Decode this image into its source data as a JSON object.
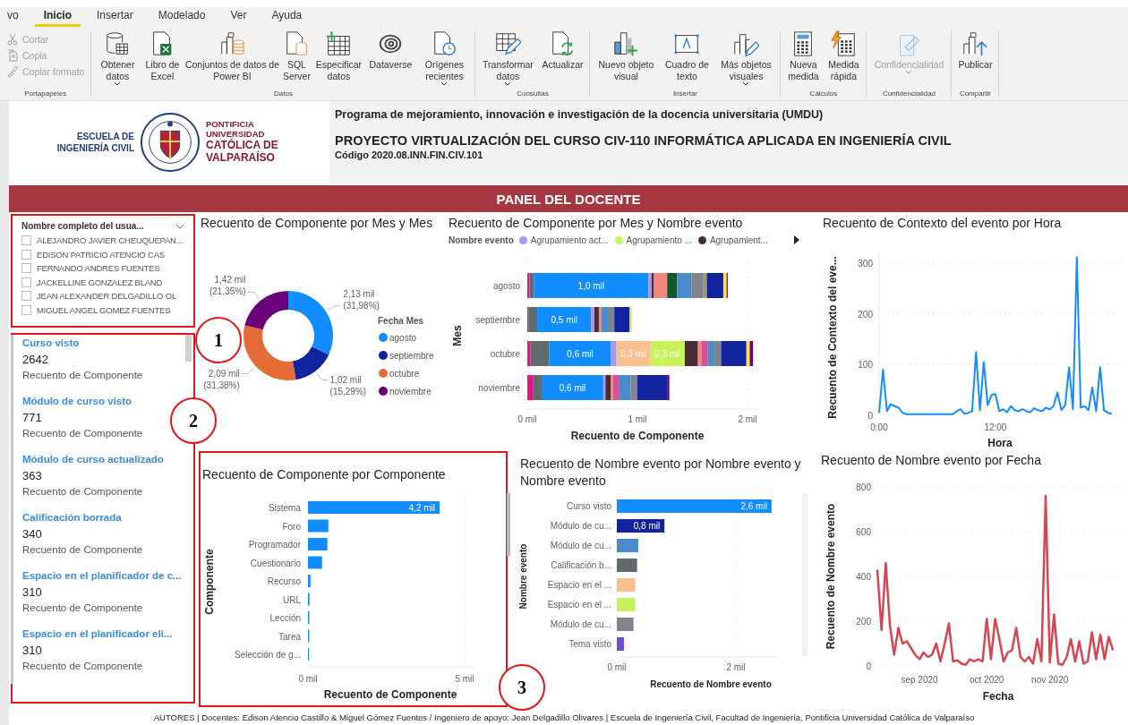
{
  "ribbon": {
    "tabs": [
      {
        "label": "vo",
        "selected": false
      },
      {
        "label": "Inicio",
        "selected": true
      },
      {
        "label": "Insertar",
        "selected": false
      },
      {
        "label": "Modelado",
        "selected": false
      },
      {
        "label": "Ver",
        "selected": false
      },
      {
        "label": "Ayuda",
        "selected": false
      }
    ],
    "groups": [
      {
        "label": "Portapapeles",
        "buttons": [
          {
            "label": "Cortar",
            "kind": "small",
            "disabled": true,
            "menu": false
          },
          {
            "label": "Copia",
            "kind": "small",
            "disabled": true,
            "menu": false
          },
          {
            "label": "Copiar formato",
            "kind": "small",
            "disabled": true,
            "menu": false
          }
        ]
      },
      {
        "label": "Datos",
        "buttons": [
          {
            "label": "Obtener datos",
            "kind": "large",
            "disabled": false,
            "menu": true
          },
          {
            "label": "Libro de Excel",
            "kind": "large",
            "disabled": false,
            "menu": false
          },
          {
            "label": "Conjuntos de datos de Power BI",
            "kind": "large",
            "disabled": false,
            "menu": false
          },
          {
            "label": "SQL Server",
            "kind": "large",
            "disabled": false,
            "menu": false
          },
          {
            "label": "Especificar datos",
            "kind": "large",
            "disabled": false,
            "menu": false
          },
          {
            "label": "Dataverse",
            "kind": "large",
            "disabled": false,
            "menu": false
          },
          {
            "label": "Orígenes recientes",
            "kind": "large",
            "disabled": false,
            "menu": true
          }
        ]
      },
      {
        "label": "Consultas",
        "buttons": [
          {
            "label": "Transformar datos",
            "kind": "large",
            "disabled": false,
            "menu": true
          },
          {
            "label": "Actualizar",
            "kind": "large",
            "disabled": false,
            "menu": false
          }
        ]
      },
      {
        "label": "Insertar",
        "buttons": [
          {
            "label": "Nuevo objeto visual",
            "kind": "large",
            "disabled": false,
            "menu": false
          },
          {
            "label": "Cuadro de texto",
            "kind": "large",
            "disabled": false,
            "menu": false
          },
          {
            "label": "Más objetos visuales",
            "kind": "large",
            "disabled": false,
            "menu": true
          }
        ]
      },
      {
        "label": "Cálculos",
        "buttons": [
          {
            "label": "Nueva medida",
            "kind": "large",
            "disabled": false,
            "menu": false
          },
          {
            "label": "Medida rápida",
            "kind": "large",
            "disabled": false,
            "menu": false
          }
        ]
      },
      {
        "label": "Confidencialidad",
        "buttons": [
          {
            "label": "Confidencialidad",
            "kind": "large",
            "disabled": true,
            "menu": true
          }
        ]
      },
      {
        "label": "Compartir",
        "buttons": [
          {
            "label": "Publicar",
            "kind": "large",
            "disabled": false,
            "menu": false
          }
        ]
      }
    ]
  },
  "header": {
    "logo": {
      "school": "ESCUELA DE INGENIERÍA CIVIL",
      "university_top": "PONTIFICIA UNIVERSIDAD",
      "university_bottom": "CATÓLICA DE VALPARAÍSO"
    },
    "program": "Programa de mejoramiento, innovación e investigación de la docencia universitaria (UMDU)",
    "project": "PROYECTO VIRTUALIZACIÓN DEL CURSO CIV-110 INFORMÁTICA APLICADA EN INGENIERÍA CIVIL",
    "code": "Código 2020.08.INN.FIN.CIV.101"
  },
  "banner": "PANEL DEL DOCENTE",
  "slicer": {
    "annotation": "1",
    "title": "Nombre completo del usua...",
    "items": [
      {
        "label": "ALEJANDRO JAVIER CHEUQUEPAN...",
        "checked": false
      },
      {
        "label": "EDISON PATRICIO ATENCIO CAS",
        "checked": false
      },
      {
        "label": "FERNANDO ANDRES FUENTES",
        "checked": false
      },
      {
        "label": "JACKELLINE GONZALEZ BLAND",
        "checked": false
      },
      {
        "label": "JEAN ALEXANDER DELGADILLO OL",
        "checked": false
      },
      {
        "label": "MIGUEL ANGEL GOMEZ FUENTES",
        "checked": false
      }
    ]
  },
  "cards": {
    "annotation": "2",
    "items": [
      {
        "title": "Curso visto",
        "value": "2642",
        "label": "Recuento de Componente"
      },
      {
        "title": "Módulo de curso visto",
        "value": "771",
        "label": "Recuento de Componente"
      },
      {
        "title": "Módulo de curso actualizado",
        "value": "363",
        "label": "Recuento de Componente"
      },
      {
        "title": "Calificación borrada",
        "value": "340",
        "label": "Recuento de Componente"
      },
      {
        "title": "Espacio en el planificador de c...",
        "value": "310",
        "label": "Recuento de Componente"
      },
      {
        "title": "Espacio en el planificador eli...",
        "value": "310",
        "label": "Recuento de Componente"
      }
    ]
  },
  "donut_chart": {
    "chart_data": {
      "type": "donut",
      "title": "Recuento de Componente por Mes y Mes",
      "legend": {
        "title": "Fecha Mes"
      },
      "categories": [
        "agosto",
        "septiembre",
        "octubre",
        "noviembre"
      ],
      "values": [
        2.13,
        1.02,
        2.09,
        1.42
      ],
      "colors": [
        "#118dff",
        "#12239e",
        "#e66c37",
        "#6b007b"
      ],
      "value_labels": [
        "2,13 mil (31,98%)",
        "1,02 mil (15,29%)",
        "2,09 mil (31,38%)",
        "1,42 mil (21,35%)"
      ]
    }
  },
  "stacked_chart": {
    "chart_data": {
      "type": "bar",
      "orientation": "horizontal",
      "stacked": true,
      "grid": true,
      "title": "Recuento de Componente por Mes y Nombre evento",
      "legend": {
        "title": "Nombre evento"
      },
      "xlabel": "Recuento de Componente",
      "ylabel": "Mes",
      "categories": [
        "agosto",
        "septiembre",
        "octubre",
        "noviembre"
      ],
      "xlim": [
        0,
        2.1
      ],
      "xticks": [
        {
          "value": 0,
          "label": "0 mil"
        },
        {
          "value": 1,
          "label": "1 mil"
        },
        {
          "value": 2,
          "label": "2 mil"
        }
      ],
      "series": [
        {
          "color": "#e6148b",
          "values": [
            0.02,
            0.01,
            0.03,
            0.05
          ]
        },
        {
          "color": "#5f6b6d",
          "values": [
            0.04,
            0.08,
            0.17,
            0.08
          ]
        },
        {
          "color": "#118dff",
          "values": [
            1.04,
            0.49,
            0.56,
            0.56
          ],
          "value_labels": [
            "1,0 mil",
            "0,5 mil",
            "0,6 mil",
            "0,6 mil"
          ]
        },
        {
          "name": "Agrupamiento act...",
          "color": "#a597f3",
          "values": [
            0.03,
            0.03,
            0.05,
            0.02
          ]
        },
        {
          "color": "#f9bf8f",
          "values": [
            0,
            0,
            0.31,
            0
          ],
          "value_labels": [
            null,
            null,
            "0,3 mil",
            null
          ]
        },
        {
          "name": "Agrupamiento ...",
          "color": "#c6f35a",
          "values": [
            0,
            0,
            0.31,
            0
          ],
          "value_labels": [
            null,
            null,
            "0,3 mil",
            null
          ]
        },
        {
          "name": "Agrupamient...",
          "color": "#4a2c36",
          "values": [
            0.02,
            0.04,
            0.12,
            0.05
          ]
        },
        {
          "color": "#f5877f",
          "values": [
            0.12,
            0.02,
            0.03,
            0.02
          ]
        },
        {
          "color": "#d64f9a",
          "values": [
            0,
            0,
            0.06,
            0.05
          ]
        },
        {
          "color": "#0f5a2a",
          "values": [
            0.09,
            0,
            0,
            0
          ]
        },
        {
          "color": "#4a8ccb",
          "values": [
            0.13,
            0.07,
            0.06,
            0.11
          ]
        },
        {
          "color": "#7f858c",
          "values": [
            0.11,
            0.05,
            0.06,
            0.06
          ]
        },
        {
          "color": "#a49488",
          "values": [
            0.03,
            0,
            0,
            0
          ]
        },
        {
          "color": "#12239e",
          "values": [
            0.15,
            0.14,
            0.23,
            0.27
          ]
        },
        {
          "color": "#f2e35a",
          "values": [
            0.03,
            0.02,
            0.03,
            0
          ]
        },
        {
          "color": "#6b007b",
          "values": [
            0.01,
            0,
            0.03,
            0.02
          ]
        }
      ]
    }
  },
  "hour_chart": {
    "chart_data": {
      "type": "line",
      "grid": true,
      "title": "Recuento de Contexto del evento por Hora",
      "xlabel": "Hora",
      "ylabel": "Recuento de Contexto del eve...",
      "categories": [
        "0:00",
        null,
        null,
        null,
        null,
        null,
        null,
        null,
        null,
        null,
        null,
        null,
        null,
        null,
        null,
        null,
        null,
        null,
        null,
        null,
        null,
        null,
        null,
        null,
        null,
        null,
        null,
        null,
        null,
        null,
        "12:00",
        null,
        null,
        null,
        null,
        null,
        null,
        null,
        null,
        null,
        null,
        null,
        null,
        null,
        null,
        null,
        null,
        null,
        null,
        null,
        null,
        null,
        null,
        null,
        null,
        null,
        null,
        null,
        null,
        null,
        null
      ],
      "ylim": [
        0,
        320
      ],
      "yticks": [
        0,
        100,
        200,
        300
      ],
      "series": [
        {
          "color": "#118dff",
          "values": [
            5,
            90,
            8,
            22,
            18,
            15,
            5,
            2,
            2,
            2,
            2,
            2,
            2,
            2,
            2,
            2,
            2,
            2,
            2,
            2,
            8,
            12,
            3,
            5,
            8,
            125,
            10,
            105,
            20,
            40,
            42,
            8,
            12,
            6,
            18,
            10,
            8,
            12,
            8,
            6,
            14,
            10,
            8,
            15,
            12,
            18,
            45,
            10,
            20,
            95,
            12,
            312,
            15,
            18,
            10,
            55,
            8,
            95,
            10,
            5,
            3
          ]
        }
      ]
    }
  },
  "component_chart": {
    "annotation": "3",
    "chart_data": {
      "type": "bar",
      "orientation": "horizontal",
      "grid": true,
      "title": "Recuento de Componente por Componente",
      "xlabel": "Recuento de Componente",
      "ylabel": "Componente",
      "categories": [
        "Sistema",
        "Foro",
        "Programador",
        "Cuestionario",
        "Recurso",
        "URL",
        "Lección",
        "Tarea",
        "Selección de g..."
      ],
      "xlim": [
        0,
        5.3
      ],
      "xticks": [
        {
          "value": 0,
          "label": "0 mil"
        },
        {
          "value": 5,
          "label": "5 mil"
        }
      ],
      "series": [
        {
          "color": "#118dff",
          "values": [
            4.2,
            0.65,
            0.62,
            0.45,
            0.08,
            0.05,
            0.04,
            0.04,
            0.03
          ],
          "value_labels": [
            "4,2 mil",
            null,
            null,
            null,
            null,
            null,
            null,
            null,
            null
          ]
        }
      ]
    }
  },
  "event_chart": {
    "chart_data": {
      "type": "bar",
      "orientation": "horizontal",
      "grid": true,
      "title": "Recuento de Nombre evento por Nombre evento y Nombre evento",
      "xlabel": "Recuento de Nombre evento",
      "ylabel": "Nombre evento",
      "categories": [
        "Curso visto",
        "Módulo de cu...",
        "Módulo de cu...",
        "Calificación b...",
        "Espacio en el ...",
        "Espacio en el ...",
        "Módulo de cu...",
        "Tema visto"
      ],
      "values": [
        2.6,
        0.8,
        0.36,
        0.34,
        0.31,
        0.31,
        0.28,
        0.12
      ],
      "colors": [
        "#118dff",
        "#12239e",
        "#4a8ccb",
        "#5f6b6d",
        "#f9bf8f",
        "#c6f35a",
        "#7f858c",
        "#744ec2"
      ],
      "value_labels": [
        "2,6 mil",
        "0,8 mil",
        null,
        null,
        null,
        null,
        null,
        null
      ],
      "xlim": [
        0,
        2.7
      ],
      "xticks": [
        {
          "value": 0,
          "label": "0 mil"
        },
        {
          "value": 2,
          "label": "2 mil"
        }
      ]
    }
  },
  "date_chart": {
    "chart_data": {
      "type": "line",
      "grid": true,
      "title": "Recuento de Nombre evento por Fecha",
      "xlabel": "Fecha",
      "ylabel": "Recuento de Nombre evento",
      "categories": [
        null,
        null,
        null,
        null,
        null,
        null,
        null,
        null,
        null,
        null,
        "sep 2020",
        null,
        null,
        null,
        null,
        null,
        null,
        null,
        null,
        null,
        null,
        null,
        null,
        null,
        null,
        null,
        "oct 2020",
        null,
        null,
        null,
        null,
        null,
        null,
        null,
        null,
        null,
        null,
        null,
        null,
        null,
        null,
        "nov 2020",
        null,
        null,
        null,
        null,
        null,
        null,
        null,
        null,
        null,
        null,
        null,
        null,
        null,
        null,
        null
      ],
      "ylim": [
        0,
        800
      ],
      "yticks": [
        0,
        200,
        400,
        600,
        800
      ],
      "series": [
        {
          "color": "#d64550",
          "values": [
            430,
            160,
            460,
            180,
            50,
            170,
            100,
            110,
            80,
            50,
            30,
            60,
            40,
            50,
            100,
            20,
            100,
            190,
            20,
            25,
            10,
            5,
            30,
            20,
            30,
            20,
            210,
            30,
            210,
            120,
            20,
            60,
            70,
            170,
            40,
            20,
            40,
            10,
            120,
            20,
            760,
            15,
            230,
            10,
            5,
            40,
            120,
            20,
            110,
            10,
            20,
            150,
            30,
            140,
            30,
            130,
            70
          ]
        }
      ]
    }
  },
  "footer": "AUTORES | Docentes: Edison Atencio Castillo & Miguel Gómez Fuentes / Ingeniero de apoyo: Jean Delgadillo Olivares | Escuela de Ingeniería Civil, Facultad de Ingeniería, Pontificia Universidad Católica de Valparaíso"
}
